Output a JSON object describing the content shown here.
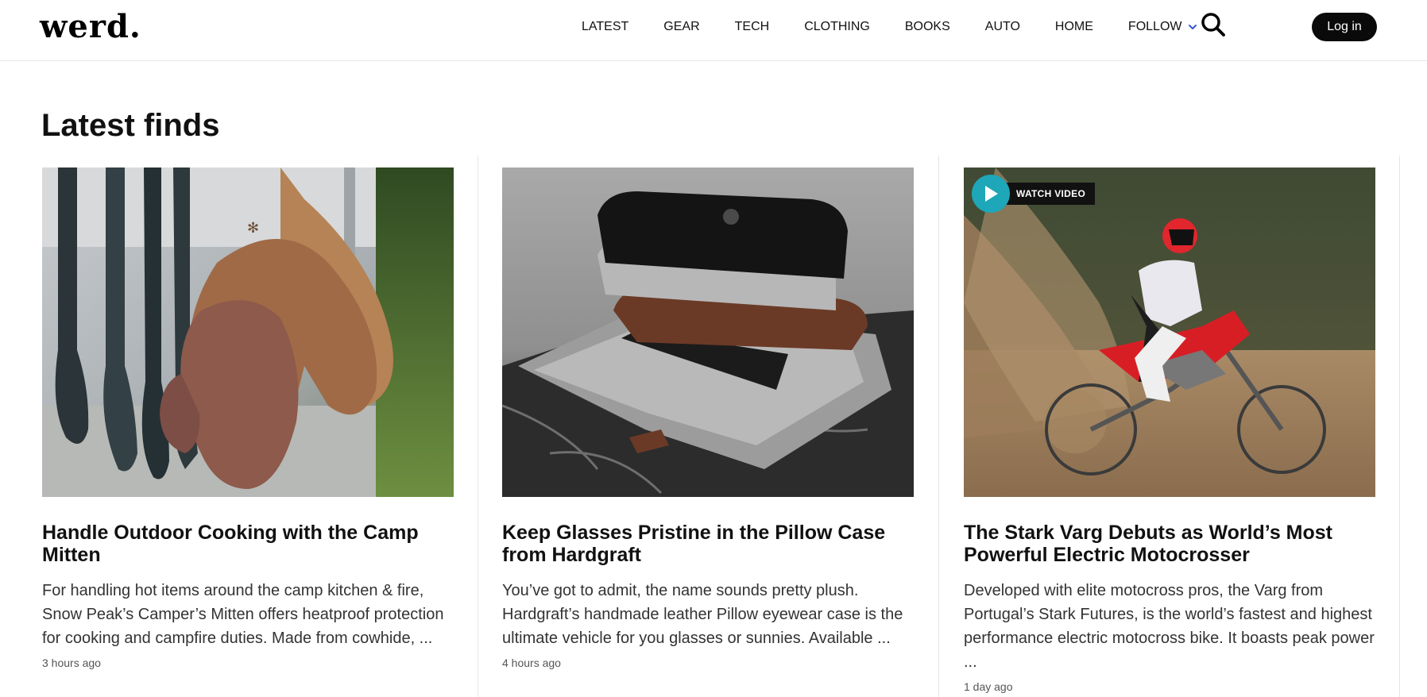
{
  "header": {
    "logo": "werd.",
    "nav": [
      {
        "label": "LATEST"
      },
      {
        "label": "GEAR"
      },
      {
        "label": "TECH"
      },
      {
        "label": "CLOTHING"
      },
      {
        "label": "BOOKS"
      },
      {
        "label": "AUTO"
      },
      {
        "label": "HOME"
      },
      {
        "label": "FOLLOW"
      }
    ],
    "login_label": "Log in",
    "icons": {
      "search": "search-icon",
      "follow_dropdown": "chevron-down-icon"
    },
    "colors": {
      "chevron": "#3a57d8",
      "login_bg": "#0a0a0a"
    }
  },
  "main": {
    "title": "Latest finds",
    "cards": [
      {
        "title": "Handle Outdoor Cooking with the Camp Mitten",
        "description": "For handling hot items around the camp kitchen & fire, Snow Peak’s Camper’s Mitten offers heatproof protection for cooking and campfire duties. Made from cowhide, ...",
        "time": "3 hours ago"
      },
      {
        "title": "Keep Glasses Pristine in the Pillow Case from Hardgraft",
        "description": "You’ve got to admit, the name sounds pretty plush. Hardgraft’s handmade leather Pillow eyewear case is the ultimate vehicle for you glasses or sunnies. Available ...",
        "time": "4 hours ago"
      },
      {
        "title": "The Stark Varg Debuts as World’s Most Powerful Electric Motocrosser",
        "description": "Developed with elite motocross pros, the Varg from Portugal’s Stark Futures, is the world’s fastest and highest performance electric motocross bike. It boasts peak power ...",
        "time": "1 day ago",
        "video_label": "WATCH VIDEO"
      }
    ],
    "colors": {
      "video_play": "#1ea7b8"
    }
  }
}
